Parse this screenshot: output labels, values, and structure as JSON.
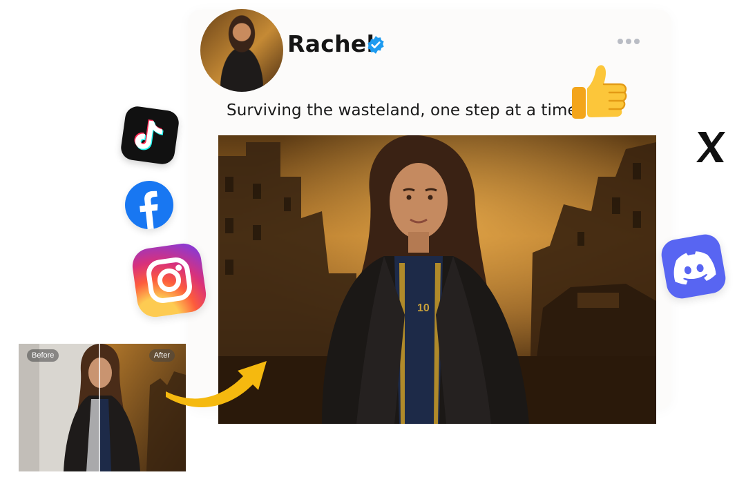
{
  "post": {
    "username": "Rachel",
    "verified": true,
    "caption": "Surviving the wasteland, one step at a time.",
    "jersey_number": "10"
  },
  "icons": {
    "more": "more-options-icon",
    "reaction": "thumbs-up-emoji",
    "socials": [
      "tiktok-icon",
      "facebook-icon",
      "instagram-icon",
      "x-icon",
      "discord-icon"
    ],
    "arrow": "curved-arrow-icon"
  },
  "before_after": {
    "before_label": "Before",
    "after_label": "After"
  },
  "colors": {
    "verified": "#1d9bf0",
    "facebook": "#1877f2",
    "discord": "#5865f2",
    "arrow": "#f5b90f"
  }
}
